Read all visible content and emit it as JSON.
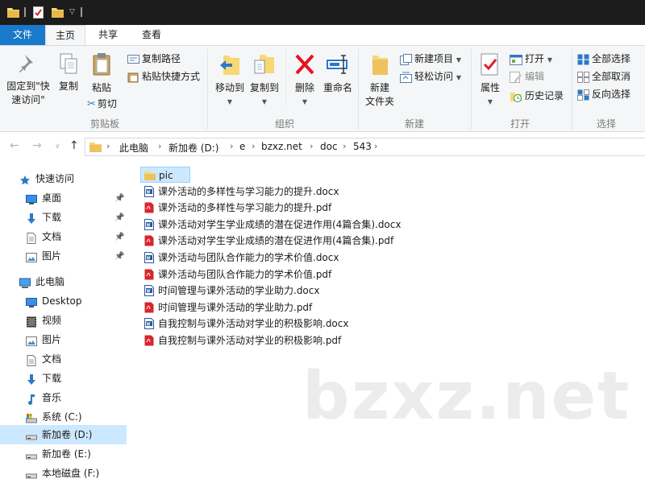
{
  "ribbon_tabs": {
    "file": "文件",
    "home": "主页",
    "share": "共享",
    "view": "查看"
  },
  "ribbon": {
    "clipboard": {
      "pin": "固定到\"快速访问\"",
      "copy": "复制",
      "paste": "粘贴",
      "copy_path": "复制路径",
      "paste_shortcut": "粘贴快捷方式",
      "cut": "剪切",
      "label": "剪贴板"
    },
    "organize": {
      "move_to": "移动到",
      "copy_to": "复制到",
      "delete": "删除",
      "rename": "重命名",
      "label": "组织"
    },
    "new": {
      "new_folder": "新建\n文件夹",
      "new_item": "新建项目",
      "easy_access": "轻松访问",
      "label": "新建"
    },
    "open": {
      "properties": "属性",
      "open": "打开",
      "edit": "编辑",
      "history": "历史记录",
      "label": "打开"
    },
    "select": {
      "select_all": "全部选择",
      "select_none": "全部取消",
      "invert": "反向选择",
      "label": "选择"
    }
  },
  "breadcrumb": [
    "此电脑",
    "新加卷 (D:)",
    "e",
    "bzxz.net",
    "doc",
    "543"
  ],
  "nav_pane": [
    {
      "label": "快速访问",
      "icon": "star-icon",
      "pinned": false
    },
    {
      "label": "桌面",
      "icon": "desktop-icon",
      "pinned": true
    },
    {
      "label": "下载",
      "icon": "download-icon",
      "pinned": true
    },
    {
      "label": "文档",
      "icon": "document-icon",
      "pinned": true
    },
    {
      "label": "图片",
      "icon": "picture-icon",
      "pinned": true
    },
    {
      "label": "此电脑",
      "icon": "computer-icon",
      "pinned": false
    },
    {
      "label": "Desktop",
      "icon": "desktop-icon",
      "pinned": false
    },
    {
      "label": "视频",
      "icon": "video-icon",
      "pinned": false
    },
    {
      "label": "图片",
      "icon": "picture-icon",
      "pinned": false
    },
    {
      "label": "文档",
      "icon": "document-icon",
      "pinned": false
    },
    {
      "label": "下载",
      "icon": "download-icon",
      "pinned": false
    },
    {
      "label": "音乐",
      "icon": "music-icon",
      "pinned": false
    },
    {
      "label": "系统 (C:)",
      "icon": "system-drive-icon",
      "pinned": false
    },
    {
      "label": "新加卷 (D:)",
      "icon": "drive-icon",
      "pinned": false,
      "selected": true
    },
    {
      "label": "新加卷 (E:)",
      "icon": "drive-icon",
      "pinned": false
    },
    {
      "label": "本地磁盘 (F:)",
      "icon": "drive-icon",
      "pinned": false
    }
  ],
  "files": [
    {
      "name": "pic",
      "type": "folder",
      "selected": true
    },
    {
      "name": "课外活动的多样性与学习能力的提升.docx",
      "type": "docx"
    },
    {
      "name": "课外活动的多样性与学习能力的提升.pdf",
      "type": "pdf"
    },
    {
      "name": "课外活动对学生学业成绩的潜在促进作用(4篇合集).docx",
      "type": "docx"
    },
    {
      "name": "课外活动对学生学业成绩的潜在促进作用(4篇合集).pdf",
      "type": "pdf"
    },
    {
      "name": "课外活动与团队合作能力的学术价值.docx",
      "type": "docx"
    },
    {
      "name": "课外活动与团队合作能力的学术价值.pdf",
      "type": "pdf"
    },
    {
      "name": "时间管理与课外活动的学业助力.docx",
      "type": "docx"
    },
    {
      "name": "时间管理与课外活动的学业助力.pdf",
      "type": "pdf"
    },
    {
      "name": "自我控制与课外活动对学业的积极影响.docx",
      "type": "docx"
    },
    {
      "name": "自我控制与课外活动对学业的积极影响.pdf",
      "type": "pdf"
    }
  ],
  "watermark": "bzxz.net",
  "colors": {
    "accent": "#1979ca",
    "selection": "#cce8ff",
    "folder": "#f8d775",
    "pdf": "#d9252b",
    "word": "#2b579a",
    "delete": "#e81123"
  }
}
